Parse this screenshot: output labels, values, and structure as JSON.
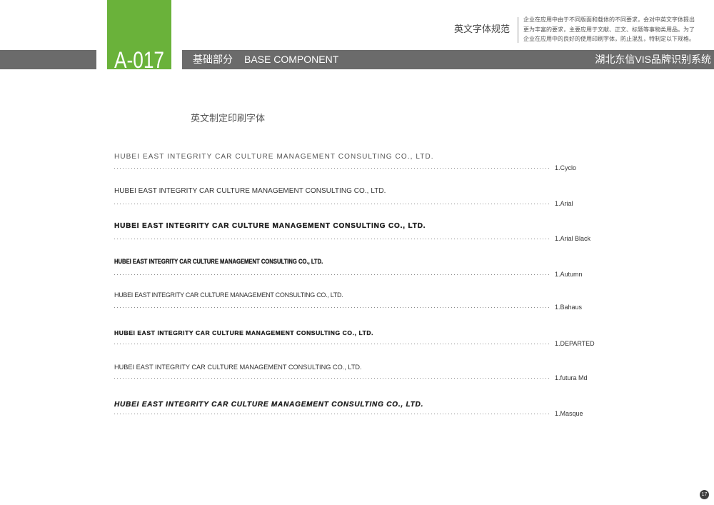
{
  "colors": {
    "accent_green": "#6ab23a",
    "band_gray": "#6b6b6b",
    "text_dark": "#333333",
    "dotted_leader": "#8a8a8a"
  },
  "header": {
    "section_code": "A-017",
    "category_cn": "基础部分",
    "category_en": "BASE COMPONENT",
    "system_title": "湖北东信VIS品牌识别系统",
    "topic_title": "英文字体规范",
    "description_lines": [
      "企业在应用中由于不同版面和载体的不同要求，会对中英文字体提出",
      "更为丰富的要求，主要应用于文献、正文、标题等事物类用品。为了",
      "企业在应用中的良好的使用印刷字体，防止混乱，特制定以下规格。"
    ]
  },
  "main": {
    "heading": "英文制定印刷字体",
    "font_samples": [
      {
        "sample": "HUBEI EAST INTEGRITY CAR CULTURE MANAGEMENT CONSULTING CO., LTD.",
        "label": "1.Cyclo"
      },
      {
        "sample": "HUBEI EAST INTEGRITY CAR CULTURE MANAGEMENT CONSULTING CO., LTD.",
        "label": "1.Arial"
      },
      {
        "sample": "HUBEI EAST INTEGRITY CAR CULTURE MANAGEMENT CONSULTING CO., LTD.",
        "label": "1.Arial Black"
      },
      {
        "sample": "HUBEI EAST INTEGRITY CAR CULTURE MANAGEMENT CONSULTING CO., LTD.",
        "label": "1.Autumn"
      },
      {
        "sample": "HUBEI EAST INTEGRITY CAR CULTURE MANAGEMENT CONSULTING CO., LTD.",
        "label": "1.Bahaus"
      },
      {
        "sample": "HUBEI EAST INTEGRITY CAR CULTURE MANAGEMENT CONSULTING CO., LTD.",
        "label": "1.DEPARTED"
      },
      {
        "sample": "HUBEI EAST INTEGRITY CAR CULTURE MANAGEMENT CONSULTING CO., LTD.",
        "label": "1.futura Md"
      },
      {
        "sample": "HUBEI EAST INTEGRITY CAR CULTURE MANAGEMENT CONSULTING CO., LTD.",
        "label": "1.Masque"
      }
    ]
  },
  "footer": {
    "page_number": "17"
  }
}
